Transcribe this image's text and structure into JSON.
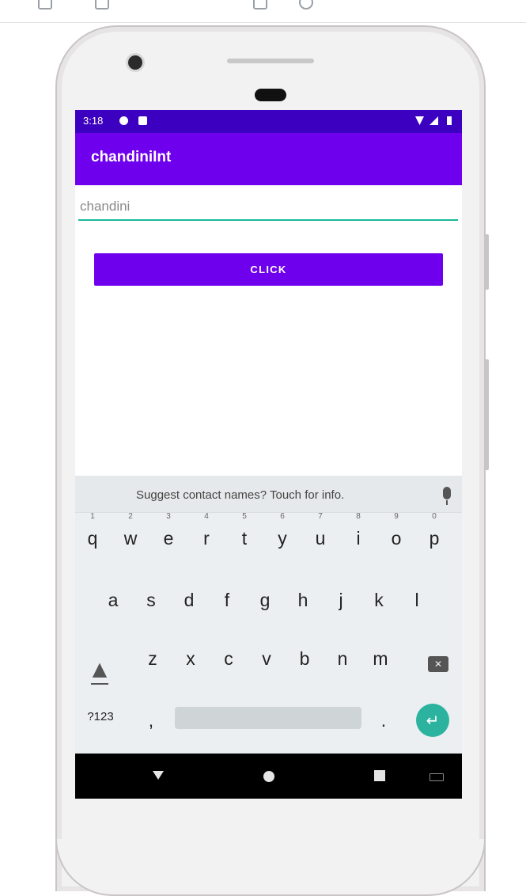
{
  "colors": {
    "primary": "#6f00ee",
    "primary_dark": "#3c00c0",
    "accent": "#18b89a",
    "enter_key": "#2bb3a0"
  },
  "statusbar": {
    "time": "3:18",
    "icons": [
      "sync-icon",
      "lock-icon",
      "wifi-icon",
      "signal-icon",
      "battery-icon"
    ]
  },
  "app": {
    "title": "chandiniInt"
  },
  "input": {
    "value": "chandini"
  },
  "button": {
    "label": "CLICK"
  },
  "keyboard": {
    "suggestion": "Suggest contact names? Touch for info.",
    "row1": [
      {
        "key": "q",
        "num": "1"
      },
      {
        "key": "w",
        "num": "2"
      },
      {
        "key": "e",
        "num": "3"
      },
      {
        "key": "r",
        "num": "4"
      },
      {
        "key": "t",
        "num": "5"
      },
      {
        "key": "y",
        "num": "6"
      },
      {
        "key": "u",
        "num": "7"
      },
      {
        "key": "i",
        "num": "8"
      },
      {
        "key": "o",
        "num": "9"
      },
      {
        "key": "p",
        "num": "0"
      }
    ],
    "row2": [
      "a",
      "s",
      "d",
      "f",
      "g",
      "h",
      "j",
      "k",
      "l"
    ],
    "row3": [
      "z",
      "x",
      "c",
      "v",
      "b",
      "n",
      "m"
    ],
    "symbols_label": "?123",
    "comma": ",",
    "period": "."
  }
}
